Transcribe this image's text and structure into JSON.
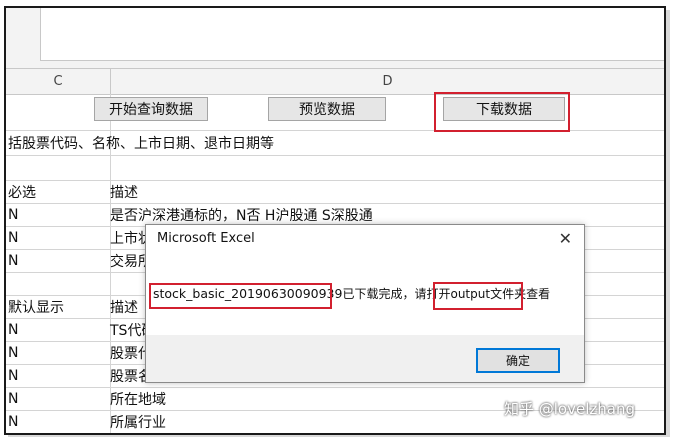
{
  "columns": [
    "C",
    "D"
  ],
  "toolbar": {
    "start_query_label": "开始查询数据",
    "preview_label": "预览数据",
    "download_label": "下载数据"
  },
  "rows": [
    {
      "c": "括股票代码、名称、上市日期、退市日期等",
      "d": ""
    },
    {
      "c": "",
      "d": ""
    },
    {
      "c": "必选",
      "d": "描述"
    },
    {
      "c": "N",
      "d": "是否沪深港通标的，N否 H沪股通 S深股通"
    },
    {
      "c": "N",
      "d": "上市状"
    },
    {
      "c": "N",
      "d": "交易所"
    },
    {
      "c": "",
      "d": ""
    },
    {
      "c": "默认显示",
      "d": "描述"
    },
    {
      "c": "N",
      "d": "TS代码"
    },
    {
      "c": "N",
      "d": "股票代"
    },
    {
      "c": "N",
      "d": "股票名"
    },
    {
      "c": "N",
      "d": "所在地域"
    },
    {
      "c": "N",
      "d": "所属行业"
    }
  ],
  "dialog": {
    "title": "Microsoft Excel",
    "filename": "stock_basic_20190630090939",
    "message_mid": "已下载完成，请打开",
    "folder": "output",
    "message_end": "文件夹查看",
    "ok_label": "确定"
  },
  "watermark": "知乎 @lovelzhang"
}
